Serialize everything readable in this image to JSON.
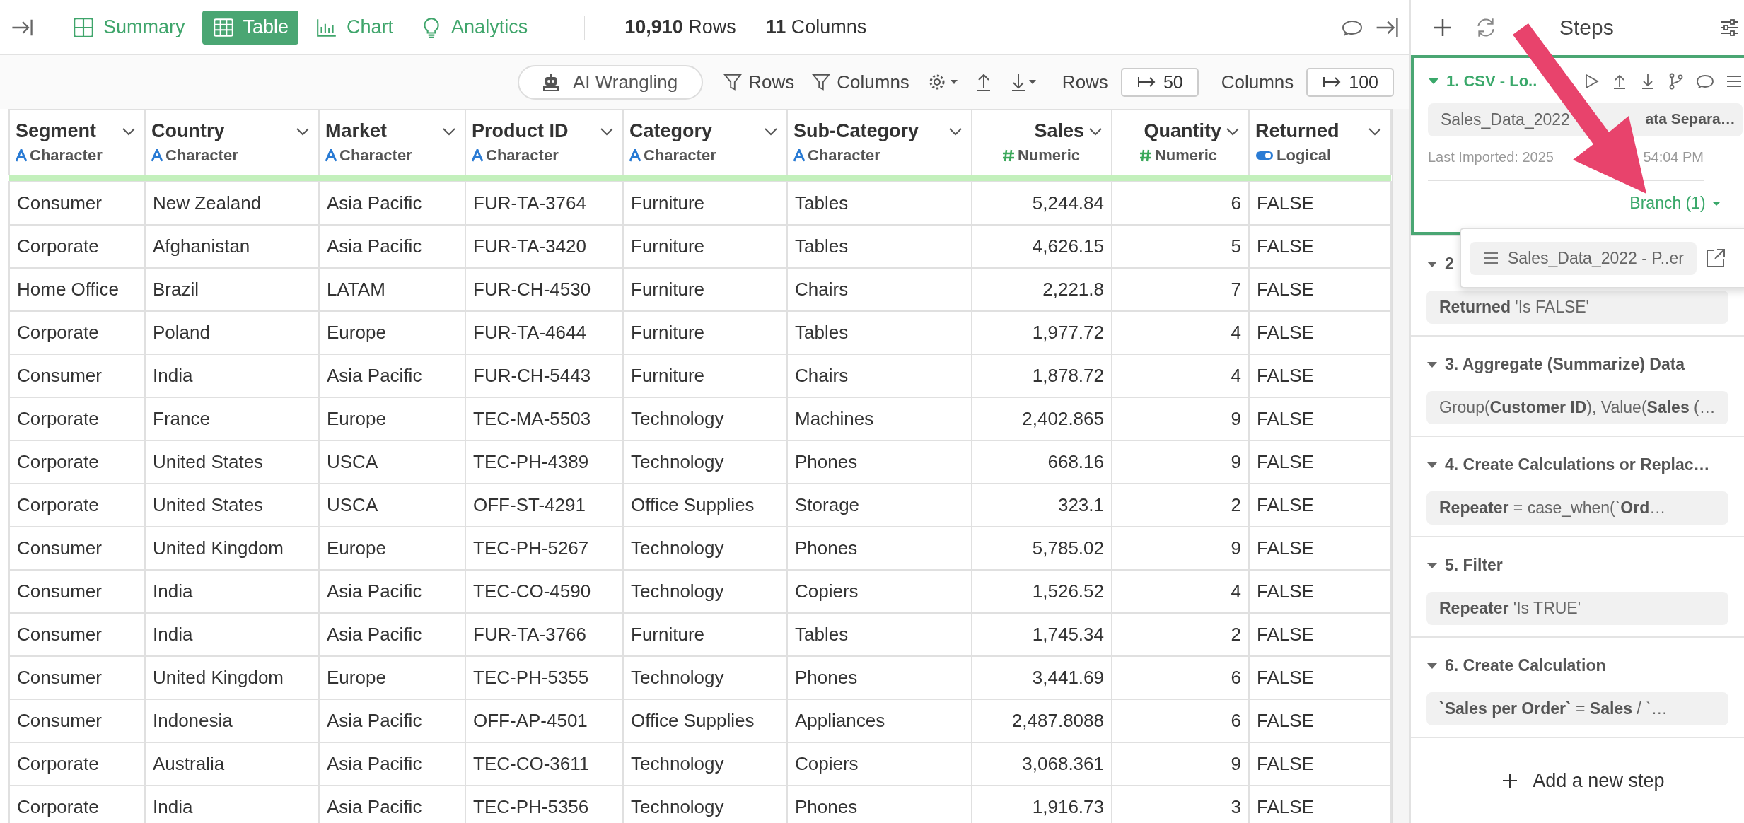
{
  "toolbar": {
    "tabs": [
      {
        "label": "Summary",
        "selected": false
      },
      {
        "label": "Table",
        "selected": true
      },
      {
        "label": "Chart",
        "selected": false
      },
      {
        "label": "Analytics",
        "selected": false
      }
    ],
    "row_count": "10,910",
    "row_label": "Rows",
    "column_count": "11",
    "column_label": "Columns"
  },
  "actions": {
    "ai_button": "AI Wrangling",
    "rows_filter": "Rows",
    "columns_filter": "Columns",
    "rows_label": "Rows",
    "rows_value": "50",
    "columns_label": "Columns",
    "columns_value": "100"
  },
  "table": {
    "columns": [
      {
        "name": "Segment",
        "type": "Character",
        "kind": "character"
      },
      {
        "name": "Country",
        "type": "Character",
        "kind": "character"
      },
      {
        "name": "Market",
        "type": "Character",
        "kind": "character"
      },
      {
        "name": "Product ID",
        "type": "Character",
        "kind": "character"
      },
      {
        "name": "Category",
        "type": "Character",
        "kind": "character"
      },
      {
        "name": "Sub-Category",
        "type": "Character",
        "kind": "character"
      },
      {
        "name": "Sales",
        "type": "Numeric",
        "kind": "numeric"
      },
      {
        "name": "Quantity",
        "type": "Numeric",
        "kind": "numeric"
      },
      {
        "name": "Returned",
        "type": "Logical",
        "kind": "logical"
      }
    ],
    "rows": [
      [
        "Consumer",
        "New Zealand",
        "Asia Pacific",
        "FUR-TA-3764",
        "Furniture",
        "Tables",
        "5,244.84",
        "6",
        "FALSE"
      ],
      [
        "Corporate",
        "Afghanistan",
        "Asia Pacific",
        "FUR-TA-3420",
        "Furniture",
        "Tables",
        "4,626.15",
        "5",
        "FALSE"
      ],
      [
        "Home Office",
        "Brazil",
        "LATAM",
        "FUR-CH-4530",
        "Furniture",
        "Chairs",
        "2,221.8",
        "7",
        "FALSE"
      ],
      [
        "Corporate",
        "Poland",
        "Europe",
        "FUR-TA-4644",
        "Furniture",
        "Tables",
        "1,977.72",
        "4",
        "FALSE"
      ],
      [
        "Consumer",
        "India",
        "Asia Pacific",
        "FUR-CH-5443",
        "Furniture",
        "Chairs",
        "1,878.72",
        "4",
        "FALSE"
      ],
      [
        "Corporate",
        "France",
        "Europe",
        "TEC-MA-5503",
        "Technology",
        "Machines",
        "2,402.865",
        "9",
        "FALSE"
      ],
      [
        "Corporate",
        "United States",
        "USCA",
        "TEC-PH-4389",
        "Technology",
        "Phones",
        "668.16",
        "9",
        "FALSE"
      ],
      [
        "Corporate",
        "United States",
        "USCA",
        "OFF-ST-4291",
        "Office Supplies",
        "Storage",
        "323.1",
        "2",
        "FALSE"
      ],
      [
        "Consumer",
        "United Kingdom",
        "Europe",
        "TEC-PH-5267",
        "Technology",
        "Phones",
        "5,785.02",
        "9",
        "FALSE"
      ],
      [
        "Consumer",
        "India",
        "Asia Pacific",
        "TEC-CO-4590",
        "Technology",
        "Copiers",
        "1,526.52",
        "4",
        "FALSE"
      ],
      [
        "Consumer",
        "India",
        "Asia Pacific",
        "FUR-TA-3766",
        "Furniture",
        "Tables",
        "1,745.34",
        "2",
        "FALSE"
      ],
      [
        "Consumer",
        "United Kingdom",
        "Europe",
        "TEC-PH-5355",
        "Technology",
        "Phones",
        "3,441.69",
        "6",
        "FALSE"
      ],
      [
        "Consumer",
        "Indonesia",
        "Asia Pacific",
        "OFF-AP-4501",
        "Office Supplies",
        "Appliances",
        "2,487.8088",
        "6",
        "FALSE"
      ],
      [
        "Corporate",
        "Australia",
        "Asia Pacific",
        "TEC-CO-3611",
        "Technology",
        "Copiers",
        "3,068.361",
        "9",
        "FALSE"
      ],
      [
        "Corporate",
        "India",
        "Asia Pacific",
        "TEC-PH-5356",
        "Technology",
        "Phones",
        "1,916.73",
        "3",
        "FALSE"
      ]
    ]
  },
  "steps_panel": {
    "title": "Steps",
    "steps": [
      {
        "title": "1. CSV - Lo..",
        "selected": true,
        "detail": "Sales_Data_2022",
        "detail_end": "ata Separa…",
        "meta": "Last Imported: 2025",
        "meta_end": "54:04 PM",
        "branch": "Branch (1)"
      },
      {
        "title": "2",
        "selected": false,
        "detail": "**Returned** 'Is FALSE'"
      },
      {
        "title": "3. Aggregate (Summarize) Data",
        "selected": false,
        "detail": "Group(**Customer ID**), Value(**Sales** (…"
      },
      {
        "title": "4. Create Calculations or Replac…",
        "selected": false,
        "detail": "**Repeater** = case_when(`**Ord**…"
      },
      {
        "title": "5. Filter",
        "selected": false,
        "detail": "**Repeater** 'Is TRUE'"
      },
      {
        "title": "6. Create Calculation",
        "selected": false,
        "detail": "**`Sales per Order`** = **Sales** / `…"
      }
    ],
    "branch_popup": {
      "item": "Sales_Data_2022 - P..er"
    },
    "add_step": "Add a new step"
  }
}
